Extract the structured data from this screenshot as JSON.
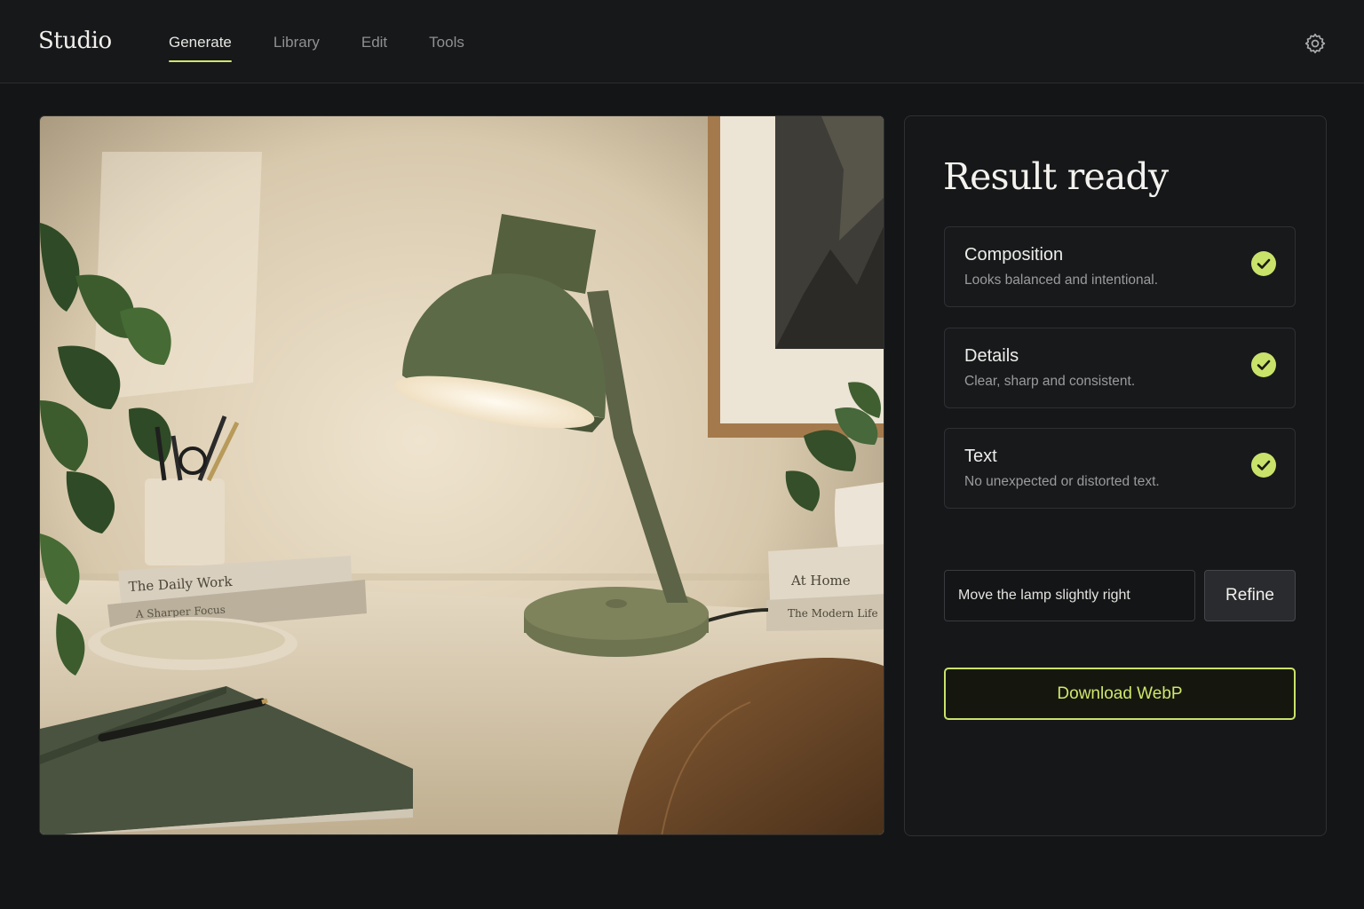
{
  "header": {
    "brand": "Studio",
    "nav": [
      {
        "label": "Generate",
        "active": true
      },
      {
        "label": "Library",
        "active": false
      },
      {
        "label": "Edit",
        "active": false
      },
      {
        "label": "Tools",
        "active": false
      }
    ],
    "settings_icon": "gear-icon"
  },
  "image": {
    "book_titles": [
      "The Daily Work",
      "A Sharper Focus",
      "At Home",
      "The Modern Life"
    ]
  },
  "panel": {
    "title": "Result ready",
    "checks": [
      {
        "title": "Composition",
        "description": "Looks balanced and intentional.",
        "status": "passed",
        "icon": "check-circle-icon"
      },
      {
        "title": "Details",
        "description": "Clear, sharp and consistent.",
        "status": "passed",
        "icon": "check-circle-icon"
      },
      {
        "title": "Text",
        "description": "No unexpected or distorted text.",
        "status": "passed",
        "icon": "check-circle-icon"
      }
    ],
    "prompt_value": "Move the lamp slightly right",
    "refine_label": "Refine",
    "download_label": "Download WebP"
  },
  "colors": {
    "accent": "#c9e26a",
    "background": "#141516",
    "card": "#18191b"
  }
}
